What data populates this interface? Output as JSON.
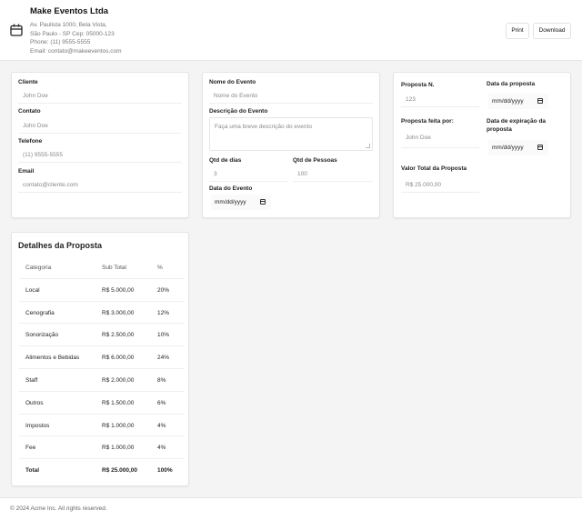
{
  "company": {
    "name": "Make Eventos Ltda",
    "address_line1": "Av. Paulista 1000, Bela Vista,",
    "address_line2": "São Paulo - SP Cep: 05000-123",
    "phone": "Phone: (11) 9555-5555",
    "email": "Email: contato@makeeventos.com"
  },
  "header": {
    "print_label": "Print",
    "download_label": "Download",
    "icon": "calendar-icon"
  },
  "client": {
    "cliente_label": "Cliente",
    "cliente_value": "John Doe",
    "contato_label": "Contato",
    "contato_value": "John Doe",
    "telefone_label": "Telefone",
    "telefone_value": "(11) 9555-5555",
    "email_label": "Email",
    "email_value": "contato@cliente.com"
  },
  "event": {
    "nome_label": "Nome do Evento",
    "nome_placeholder": "Nome do Evento",
    "descricao_label": "Descrição do Evento",
    "descricao_placeholder": "Faça uma breve descrição do evento",
    "dias_label": "Qtd de dias",
    "dias_value": "3",
    "pessoas_label": "Qtd de Pessoas",
    "pessoas_value": "100",
    "data_label": "Data do Evento",
    "data_value": "mm/dd/yyyy"
  },
  "proposal": {
    "numero_label": "Proposta N.",
    "numero_value": "123",
    "data_label": "Data da proposta",
    "data_value": "mm/dd/yyyy",
    "feita_label": "Proposta feita por:",
    "feita_value": "John Doe",
    "expiracao_label_1": "Data de expiração da",
    "expiracao_label_2": "proposta",
    "expiracao_value": "mm/dd/yyyy",
    "valor_label": "Valor Total da Proposta",
    "valor_value": "R$ 25.000,00"
  },
  "details": {
    "title": "Detalhes da Proposta",
    "columns": [
      "Categoria",
      "Sub Total",
      "%"
    ],
    "rows": [
      [
        "Local",
        "R$ 5.000,00",
        "20%"
      ],
      [
        "Cenografia",
        "R$ 3.000,00",
        "12%"
      ],
      [
        "Sonorização",
        "R$ 2.500,00",
        "10%"
      ],
      [
        "Alimentos e Bebidas",
        "R$ 6.000,00",
        "24%"
      ],
      [
        "Staff",
        "R$ 2.000,00",
        "8%"
      ],
      [
        "Outros",
        "R$ 1.500,00",
        "6%"
      ],
      [
        "Impostos",
        "R$ 1.000,00",
        "4%"
      ],
      [
        "Fee",
        "R$ 1.000,00",
        "4%"
      ]
    ],
    "total": [
      "Total",
      "R$ 25.000,00",
      "100%"
    ]
  },
  "footer": {
    "text": "© 2024 Acme Inc. All rights reserved."
  }
}
